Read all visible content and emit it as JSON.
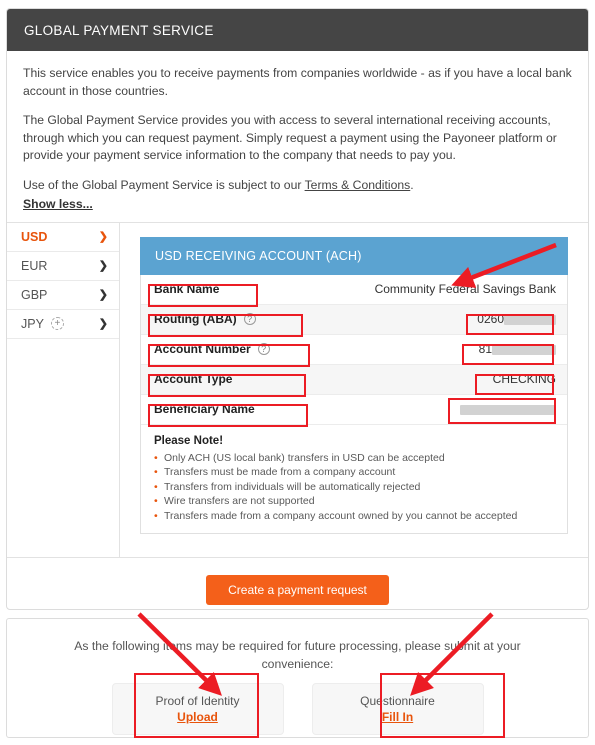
{
  "header": {
    "title": "GLOBAL PAYMENT SERVICE"
  },
  "intro": {
    "p1": "This service enables you to receive payments from companies worldwide - as if you have a local bank account in those countries.",
    "p2": "The Global Payment Service provides you with access to several international receiving accounts, through which you can request payment. Simply request a payment using the Payoneer platform or provide your payment service information to the company that needs to pay you.",
    "p3_prefix": "Use of the Global Payment Service is subject to our ",
    "p3_link": "Terms & Conditions",
    "p3_suffix": ".",
    "show_less": "Show less..."
  },
  "sidebar": {
    "items": [
      {
        "code": "USD",
        "active": true,
        "plus": false
      },
      {
        "code": "EUR",
        "active": false,
        "plus": false
      },
      {
        "code": "GBP",
        "active": false,
        "plus": false
      },
      {
        "code": "JPY",
        "active": false,
        "plus": true
      }
    ],
    "plus_glyph": "+",
    "chevron_glyph": "❯"
  },
  "account": {
    "panel_title": "USD RECEIVING ACCOUNT (ACH)",
    "help_glyph": "?",
    "rows": [
      {
        "label": "Bank Name",
        "value": "Community Federal Savings Bank",
        "help": false,
        "masked": false
      },
      {
        "label": "Routing (ABA)",
        "value": "0260",
        "help": true,
        "masked": true,
        "mask_width": 52
      },
      {
        "label": "Account Number",
        "value": "81",
        "help": true,
        "masked": true,
        "mask_width": 64
      },
      {
        "label": "Account Type",
        "value": "CHECKING",
        "help": false,
        "masked": false
      },
      {
        "label": "Beneficiary Name",
        "value": "",
        "help": false,
        "masked": true,
        "mask_width": 96
      }
    ],
    "note_title": "Please Note!",
    "notes": [
      "Only ACH (US local bank) transfers in USD can be accepted",
      "Transfers must be made from a company account",
      "Transfers from individuals will be automatically rejected",
      "Wire transfers are not supported",
      "Transfers made from a company account owned by you cannot be accepted"
    ]
  },
  "cta": {
    "label": "Create a payment request"
  },
  "docs": {
    "prompt": "As the following items may be required for future processing, please submit at your convenience:",
    "tiles": [
      {
        "name": "Proof of Identity",
        "action": "Upload"
      },
      {
        "name": "Questionnaire",
        "action": "Fill In"
      }
    ]
  },
  "colors": {
    "header_bar": "#454545",
    "accent_orange": "#e8540c",
    "button_orange": "#f4601a",
    "panel_blue": "#5ba3d1",
    "annotation_red": "#ec1c24"
  }
}
